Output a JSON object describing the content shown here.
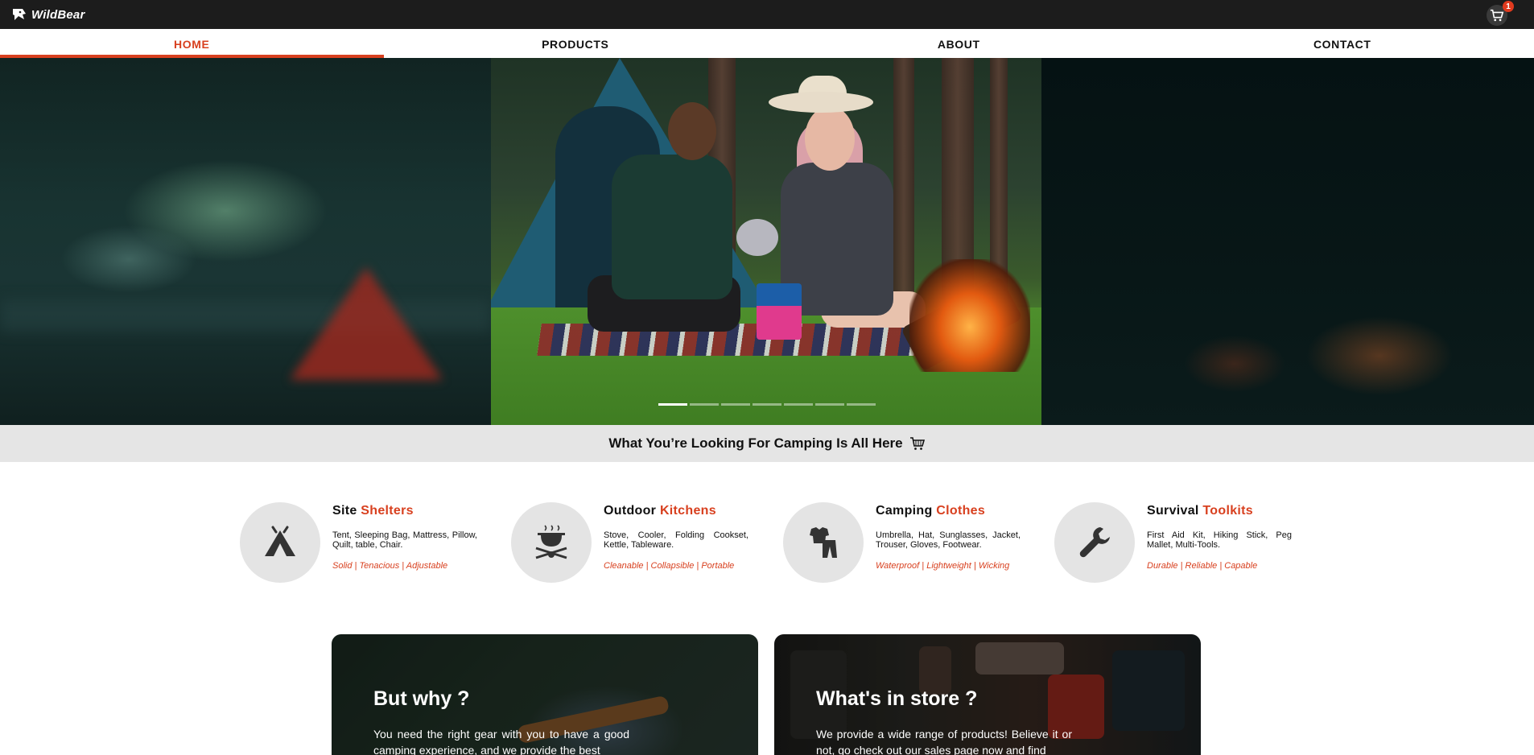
{
  "brand": {
    "name": "WildBear"
  },
  "header": {
    "cart_count": "1",
    "cart_icon": "cart-icon"
  },
  "nav": {
    "items": [
      {
        "label": "HOME",
        "active": true
      },
      {
        "label": "PRODUCTS",
        "active": false
      },
      {
        "label": "ABOUT",
        "active": false
      },
      {
        "label": "CONTACT",
        "active": false
      }
    ]
  },
  "carousel": {
    "slide_count": 7,
    "active_index": 0
  },
  "banner": {
    "text": "What You’re Looking For Camping Is All Here",
    "icon": "cart-icon"
  },
  "features": [
    {
      "title_a": "Site",
      "title_b": "Shelters",
      "icon": "tent-icon",
      "desc": "Tent, Sleeping Bag, Mattress, Pillow, Quilt, table, Chair.",
      "tags": [
        "Solid",
        "Tenacious",
        "Adjustable"
      ]
    },
    {
      "title_a": "Outdoor",
      "title_b": "Kitchens",
      "icon": "cooking-pot-icon",
      "desc": "Stove, Cooler, Folding Cookset, Kettle, Tableware.",
      "tags": [
        "Cleanable",
        "Collapsible",
        "Portable"
      ]
    },
    {
      "title_a": "Camping",
      "title_b": "Clothes",
      "icon": "clothes-icon",
      "desc": "Umbrella, Hat, Sunglasses, Jacket, Trouser, Gloves, Footwear.",
      "tags": [
        "Waterproof",
        "Lightweight",
        "Wicking"
      ]
    },
    {
      "title_a": "Survival",
      "title_b": "Toolkits",
      "icon": "wrench-icon",
      "desc": "First Aid Kit, Hiking Stick, Peg Mallet, Multi-Tools.",
      "tags": [
        "Durable",
        "Reliable",
        "Capable"
      ]
    }
  ],
  "cards": [
    {
      "title": "But why ?",
      "text": "You need the right gear with you to have a good camping experience, and we provide the best"
    },
    {
      "title": "What's in store ?",
      "text": "We provide a wide range of products! Believe it or not, go check out our sales page now and find"
    }
  ],
  "colors": {
    "accent": "#d8401f",
    "topbar": "#1c1c1c",
    "banner_bg": "#e5e5e5"
  }
}
